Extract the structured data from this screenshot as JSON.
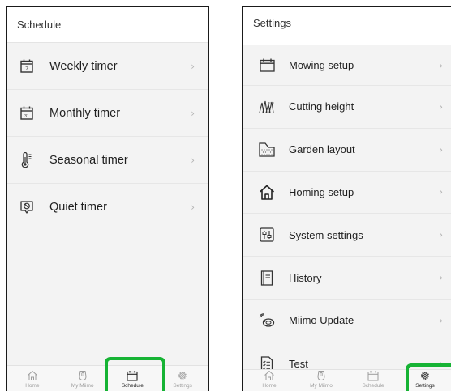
{
  "schedule_screen": {
    "title": "Schedule",
    "items": [
      {
        "label": "Weekly timer",
        "icon": "weekly-calendar-icon",
        "icon_text": "7"
      },
      {
        "label": "Monthly timer",
        "icon": "monthly-calendar-icon",
        "icon_text": "31"
      },
      {
        "label": "Seasonal timer",
        "icon": "thermometer-icon"
      },
      {
        "label": "Quiet timer",
        "icon": "quiet-icon"
      }
    ],
    "chevron": "›",
    "tabs": [
      {
        "label": "Home",
        "icon": "home-icon"
      },
      {
        "label": "My Miimo",
        "icon": "mower-icon"
      },
      {
        "label": "Schedule",
        "icon": "calendar-icon",
        "active": true
      },
      {
        "label": "Settings",
        "icon": "gear-icon"
      }
    ]
  },
  "settings_screen": {
    "title": "Settings",
    "items": [
      {
        "label": "Mowing setup",
        "icon": "calendar-icon"
      },
      {
        "label": "Cutting height",
        "icon": "grass-icon"
      },
      {
        "label": "Garden layout",
        "icon": "garden-layout-icon"
      },
      {
        "label": "Homing setup",
        "icon": "home-icon"
      },
      {
        "label": "System settings",
        "icon": "system-settings-icon"
      },
      {
        "label": "History",
        "icon": "history-book-icon"
      },
      {
        "label": "Miimo Update",
        "icon": "update-icon"
      },
      {
        "label": "Test",
        "icon": "test-checklist-icon"
      }
    ],
    "chevron": "›",
    "tabs": [
      {
        "label": "Home",
        "icon": "home-icon"
      },
      {
        "label": "My Miimo",
        "icon": "mower-icon"
      },
      {
        "label": "Schedule",
        "icon": "calendar-icon"
      },
      {
        "label": "Settings",
        "icon": "gear-icon",
        "active": true
      }
    ]
  },
  "colors": {
    "highlight": "#16b334",
    "tab_inactive": "#9c9c9c",
    "chevron": "#b4b4b4",
    "list_background": "#f3f3f3"
  }
}
